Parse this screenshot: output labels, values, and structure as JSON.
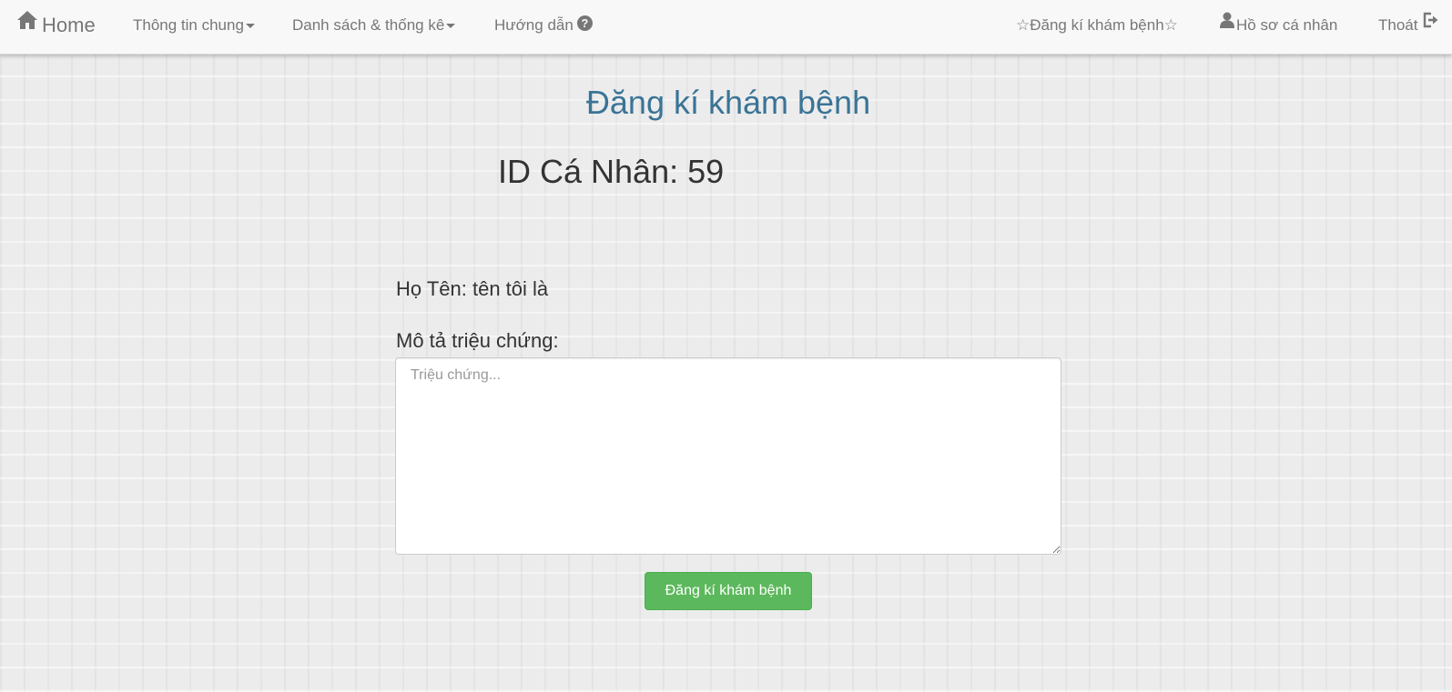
{
  "navbar": {
    "brand": {
      "label": "Home",
      "icon": "home-icon"
    },
    "left_items": [
      {
        "label": "Thông tin chung",
        "icon": "caret-down-icon"
      },
      {
        "label": "Danh sách & thống kê",
        "icon": "caret-down-icon"
      },
      {
        "label": "Hướng dẫn",
        "icon": "question-circle-icon"
      }
    ],
    "right_items": [
      {
        "label": "☆Đăng kí khám bệnh☆"
      },
      {
        "label": "Hồ sơ cá nhân",
        "icon": "user-icon"
      },
      {
        "label": "Thoát",
        "icon": "logout-icon"
      }
    ]
  },
  "main": {
    "title": "Đăng kí khám bệnh",
    "id_line": "ID Cá Nhân: 59",
    "name_line": "Họ Tên: tên tôi là",
    "symptom_label": "Mô tả triệu chứng:",
    "symptom_input": {
      "placeholder": "Triệu chứng...",
      "value": ""
    },
    "submit_label": "Đăng kí khám bệnh"
  },
  "colors": {
    "title": "#3a7496",
    "button": "#5cb85c",
    "nav_text": "#777777",
    "navbar_bg": "#f8f8f8"
  }
}
